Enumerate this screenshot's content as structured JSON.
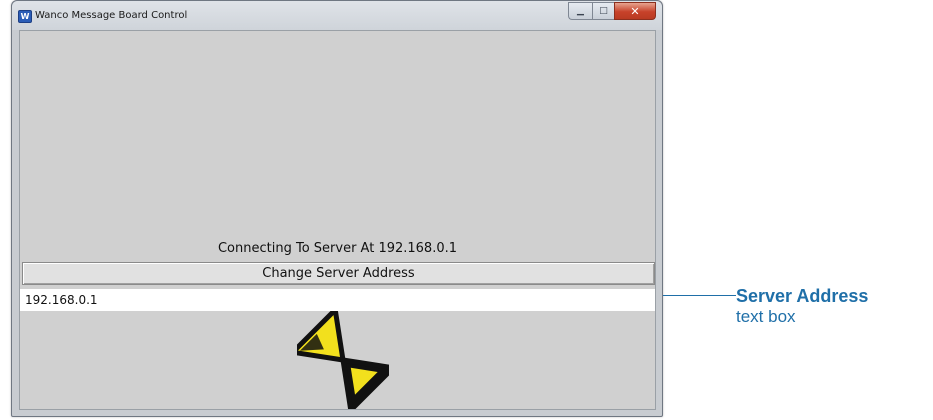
{
  "window": {
    "title": "Wanco Message Board Control",
    "icon": "wanco-app-icon",
    "icon_letter": "W",
    "controls": {
      "minimize_icon": "minimize-icon",
      "maximize_icon": "maximize-icon",
      "close_icon": "close-icon"
    }
  },
  "main": {
    "status": "Connecting To Server At 192.168.0.1",
    "change_server_button": "Change Server Address",
    "server_address_value": "192.168.0.1",
    "busy_icon": "hourglass-icon"
  },
  "callout": {
    "title": "Server Address",
    "subtitle": "text box",
    "color": "#1f6fa8"
  },
  "colors": {
    "client_background": "#d0d0d0",
    "hourglass_fill": "#f2e01d",
    "hourglass_outline": "#111111"
  }
}
